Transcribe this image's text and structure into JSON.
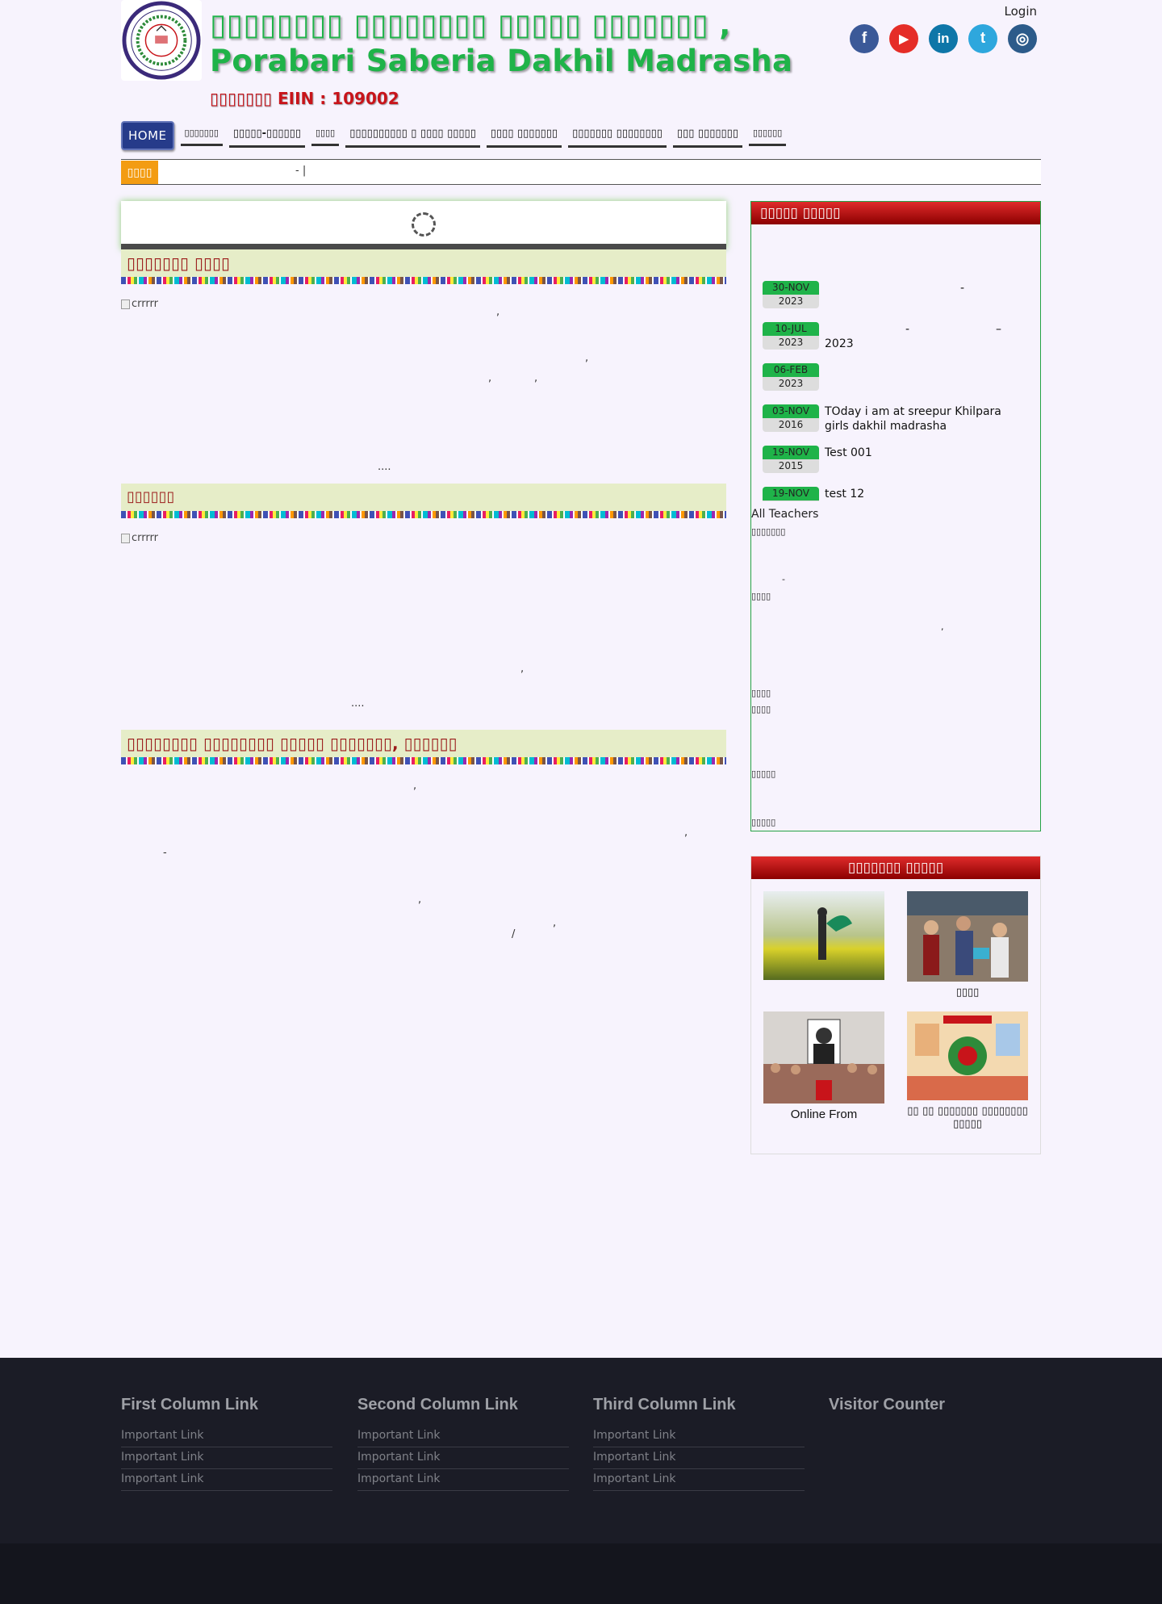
{
  "header": {
    "title_line1": "▯▯▯▯▯▯▯▯ ▯▯▯▯▯▯▯▯ ▯▯▯▯▯ ▯▯▯▯▯▯▯ ,",
    "title_line2": "Porabari Saberia Dakhil Madrasha",
    "eiin": "▯▯▯▯▯▯▯ EIIN : 109002",
    "login": "Login",
    "social": [
      {
        "icon": "facebook-icon",
        "glyph": "f",
        "color": "#3b5998"
      },
      {
        "icon": "youtube-icon",
        "glyph": "▶",
        "color": "#e52d27"
      },
      {
        "icon": "linkedin-icon",
        "glyph": "in",
        "color": "#0e76a8"
      },
      {
        "icon": "twitter-icon",
        "glyph": "t",
        "color": "#2ea7dd"
      },
      {
        "icon": "instagram-icon",
        "glyph": "◎",
        "color": "#2c5b8a"
      }
    ]
  },
  "nav": {
    "items": [
      "HOME",
      "▯▯▯▯▯▯▯",
      "▯▯▯▯▯-▯▯▯▯▯▯",
      "▯▯▯▯",
      "▯▯▯▯▯▯▯▯▯▯ ▯ ▯▯▯▯ ▯▯▯▯▯",
      "▯▯▯▯ ▯▯▯▯▯▯▯",
      "▯▯▯▯▯▯▯ ▯▯▯▯▯▯▯▯",
      "▯▯▯ ▯▯▯▯▯▯▯",
      "▯▯▯▯▯▯"
    ]
  },
  "ticker": {
    "label": "▯▯▯▯",
    "text": "-        |"
  },
  "main": {
    "section1_title": "▯▯▯▯▯▯▯ ▯▯▯▯",
    "section2_title": "▯▯▯▯▯▯",
    "section3_title": "▯▯▯▯▯▯▯▯ ▯▯▯▯▯▯▯▯ ▯▯▯▯▯ ▯▯▯▯▯▯▯, ▯▯▯▯▯▯",
    "img_alt": "crrrrr",
    "more": "...."
  },
  "sidebar": {
    "notice_title": "▯▯▯▯▯ ▯▯▯▯▯",
    "news": [
      {
        "month": "30-NOV",
        "year": "2023",
        "text": "-"
      },
      {
        "month": "10-JUL",
        "year": "2023",
        "text": "2023"
      },
      {
        "month": "06-FEB",
        "year": "2023",
        "text": ""
      },
      {
        "month": "03-NOV",
        "year": "2016",
        "text": "TOday i am at sreepur Khilpara girls dakhil madrasha"
      },
      {
        "month": "19-NOV",
        "year": "2015",
        "text": "Test 001"
      },
      {
        "month": "19-NOV",
        "year": "2015",
        "text": "test 12"
      }
    ],
    "all_teachers": "All Teachers",
    "teachers": [
      "▯▯▯▯▯▯▯",
      "-",
      "▯▯▯▯",
      ",",
      "▯▯▯▯",
      "▯▯▯▯",
      "▯▯▯▯▯",
      "▯▯▯▯▯"
    ],
    "gallery_title": "▯▯▯▯▯▯▯ ▯▯▯▯▯",
    "gallery": [
      {
        "caption": ""
      },
      {
        "caption": "▯▯▯▯"
      },
      {
        "caption": "Online From"
      },
      {
        "caption": "▯▯ ▯▯ ▯▯▯▯▯▯▯ ▯▯▯▯▯▯▯▯ ▯▯▯▯▯"
      }
    ]
  },
  "footer": {
    "columns": [
      {
        "title": "First Column Link",
        "links": [
          "Important Link",
          "Important Link",
          "Important Link"
        ]
      },
      {
        "title": "Second Column Link",
        "links": [
          "Important Link",
          "Important Link",
          "Important Link"
        ]
      },
      {
        "title": "Third Column Link",
        "links": [
          "Important Link",
          "Important Link",
          "Important Link"
        ]
      },
      {
        "title": "Visitor Counter",
        "links": []
      }
    ]
  }
}
